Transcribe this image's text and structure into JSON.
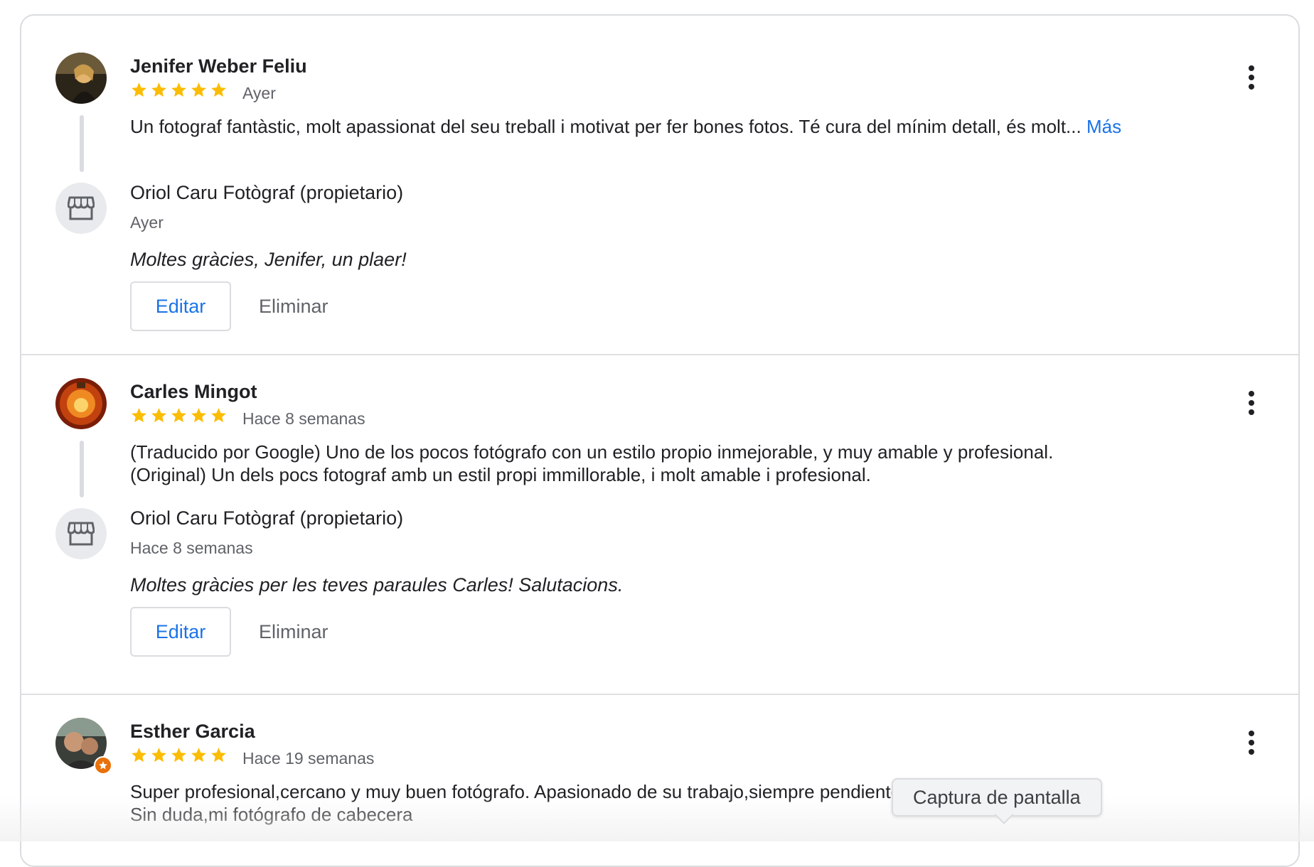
{
  "colors": {
    "star": "#fbbc04",
    "link": "#1a73e8",
    "secondary_text": "#5f6368",
    "divider": "#dadce0"
  },
  "reviews": [
    {
      "author": "Jenifer Weber Feliu",
      "rating": 5,
      "date": "Ayer",
      "text": "Un fotograf fantàstic, molt apassionat del seu treball i motivat per fer bones fotos. Té cura del mínim detall, és molt...",
      "more_label": "Más",
      "owner_name": "Oriol Caru Fotògraf (propietario)",
      "owner_date": "Ayer",
      "owner_reply": "Moltes gràcies, Jenifer, un plaer!",
      "edit_label": "Editar",
      "delete_label": "Eliminar"
    },
    {
      "author": "Carles Mingot",
      "rating": 5,
      "date": "Hace 8 semanas",
      "text_line1": "(Traducido por Google) Uno de los pocos fotógrafo con un estilo propio inmejorable, y muy amable y profesional.",
      "text_line2": "(Original) Un dels pocs fotograf amb un estil propi immillorable, i molt amable i profesional.",
      "owner_name": "Oriol Caru Fotògraf (propietario)",
      "owner_date": "Hace 8 semanas",
      "owner_reply": "Moltes gràcies per les teves paraules Carles! Salutacions.",
      "edit_label": "Editar",
      "delete_label": "Eliminar"
    },
    {
      "author": "Esther Garcia",
      "rating": 5,
      "date": "Hace 19 semanas",
      "text_line1": "Super profesional,cercano y muy buen fotógrafo. Apasionado de su trabajo,siempre pendiente del más mínimo detalle.",
      "text_line2": "Sin duda,mi fotógrafo de cabecera"
    }
  ],
  "tooltip": {
    "label": "Captura de pantalla"
  }
}
